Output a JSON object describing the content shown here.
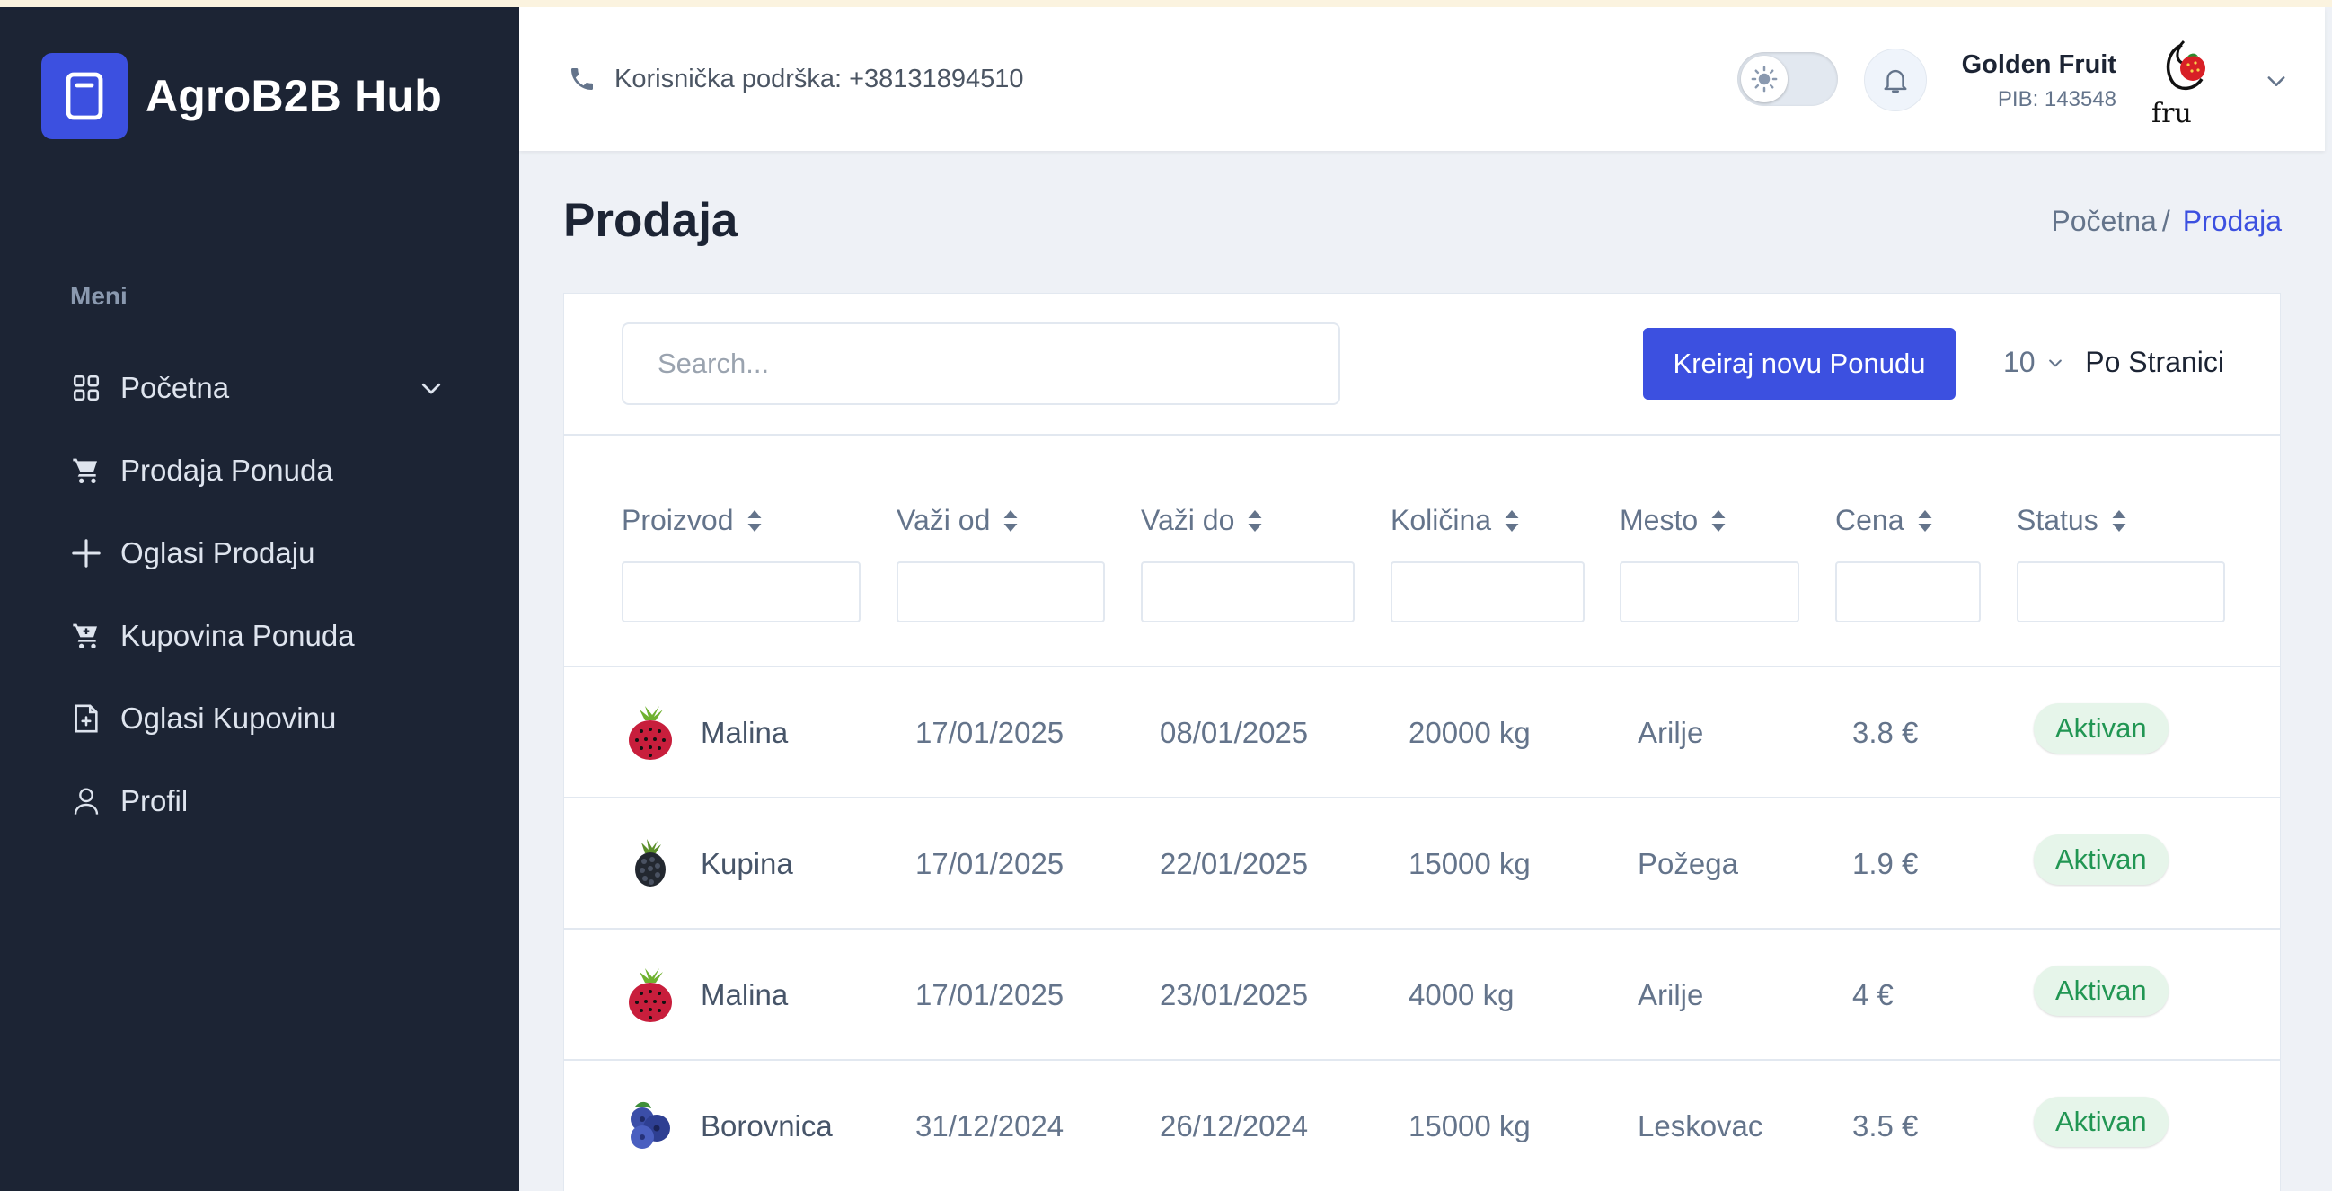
{
  "app": {
    "name": "AgroB2B Hub"
  },
  "sidebar": {
    "menu_title": "Meni",
    "items": [
      {
        "label": "Početna",
        "icon": "grid-icon",
        "has_dropdown": true
      },
      {
        "label": "Prodaja Ponuda",
        "icon": "cart-icon"
      },
      {
        "label": "Oglasi Prodaju",
        "icon": "plus-icon"
      },
      {
        "label": "Kupovina Ponuda",
        "icon": "cart-plus-icon"
      },
      {
        "label": "Oglasi Kupovinu",
        "icon": "document-icon"
      },
      {
        "label": "Profil",
        "icon": "user-icon"
      }
    ]
  },
  "header": {
    "support_text": "Korisnička podrška: +38131894510",
    "company_name": "Golden Fruit",
    "company_pib": "PIB: 143548",
    "avatar_text": "fru"
  },
  "page": {
    "title": "Prodaja",
    "breadcrumb": {
      "home": "Početna",
      "separator": "/",
      "current": "Prodaja"
    }
  },
  "toolbar": {
    "search_placeholder": "Search...",
    "create_label": "Kreiraj novu Ponudu",
    "per_page_value": "10",
    "per_page_label": "Po Stranici"
  },
  "table": {
    "columns": [
      "Proizvod",
      "Važi od",
      "Važi do",
      "Količina",
      "Mesto",
      "Cena",
      "Status"
    ],
    "rows": [
      {
        "product": "Malina",
        "icon": "raspberry-icon",
        "from": "17/01/2025",
        "to": "08/01/2025",
        "quantity": "20000 kg",
        "place": "Arilje",
        "price": "3.8 €",
        "status": "Aktivan"
      },
      {
        "product": "Kupina",
        "icon": "blackberry-icon",
        "from": "17/01/2025",
        "to": "22/01/2025",
        "quantity": "15000 kg",
        "place": "Požega",
        "price": "1.9 €",
        "status": "Aktivan"
      },
      {
        "product": "Malina",
        "icon": "raspberry-icon",
        "from": "17/01/2025",
        "to": "23/01/2025",
        "quantity": "4000 kg",
        "place": "Arilje",
        "price": "4 €",
        "status": "Aktivan"
      },
      {
        "product": "Borovnica",
        "icon": "blueberry-icon",
        "from": "31/12/2024",
        "to": "26/12/2024",
        "quantity": "15000 kg",
        "place": "Leskovac",
        "price": "3.5 €",
        "status": "Aktivan"
      }
    ]
  },
  "colors": {
    "sidebar_bg": "#1c2434",
    "primary": "#3c50e0",
    "status_bg": "#e6f5ea",
    "status_text": "#219653"
  }
}
